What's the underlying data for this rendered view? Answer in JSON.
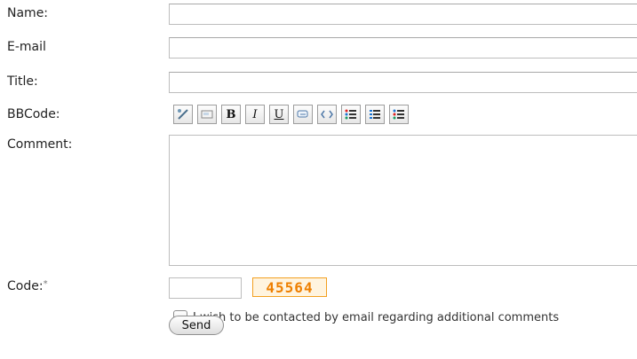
{
  "labels": {
    "name": "Name:",
    "email": "E-mail",
    "title": "Title:",
    "bbcode": "BBCode:",
    "comment": "Comment:",
    "code": "Code:",
    "code_required": "*"
  },
  "inputs": {
    "name": "",
    "email": "",
    "title": "",
    "comment": "",
    "code": ""
  },
  "toolbar_buttons": [
    {
      "icon": "link-icon"
    },
    {
      "icon": "image-icon"
    },
    {
      "icon": "bold-icon",
      "text": "B"
    },
    {
      "icon": "italic-icon",
      "text": "I"
    },
    {
      "icon": "underline-icon",
      "text": "U"
    },
    {
      "icon": "quote-icon"
    },
    {
      "icon": "code-icon"
    },
    {
      "icon": "bullet-list-icon"
    },
    {
      "icon": "numbered-list-icon"
    },
    {
      "icon": "list-icon"
    }
  ],
  "captcha_text": "45564",
  "checkbox_label": "I wish to be contacted by email regarding additional comments",
  "send_label": "Send"
}
